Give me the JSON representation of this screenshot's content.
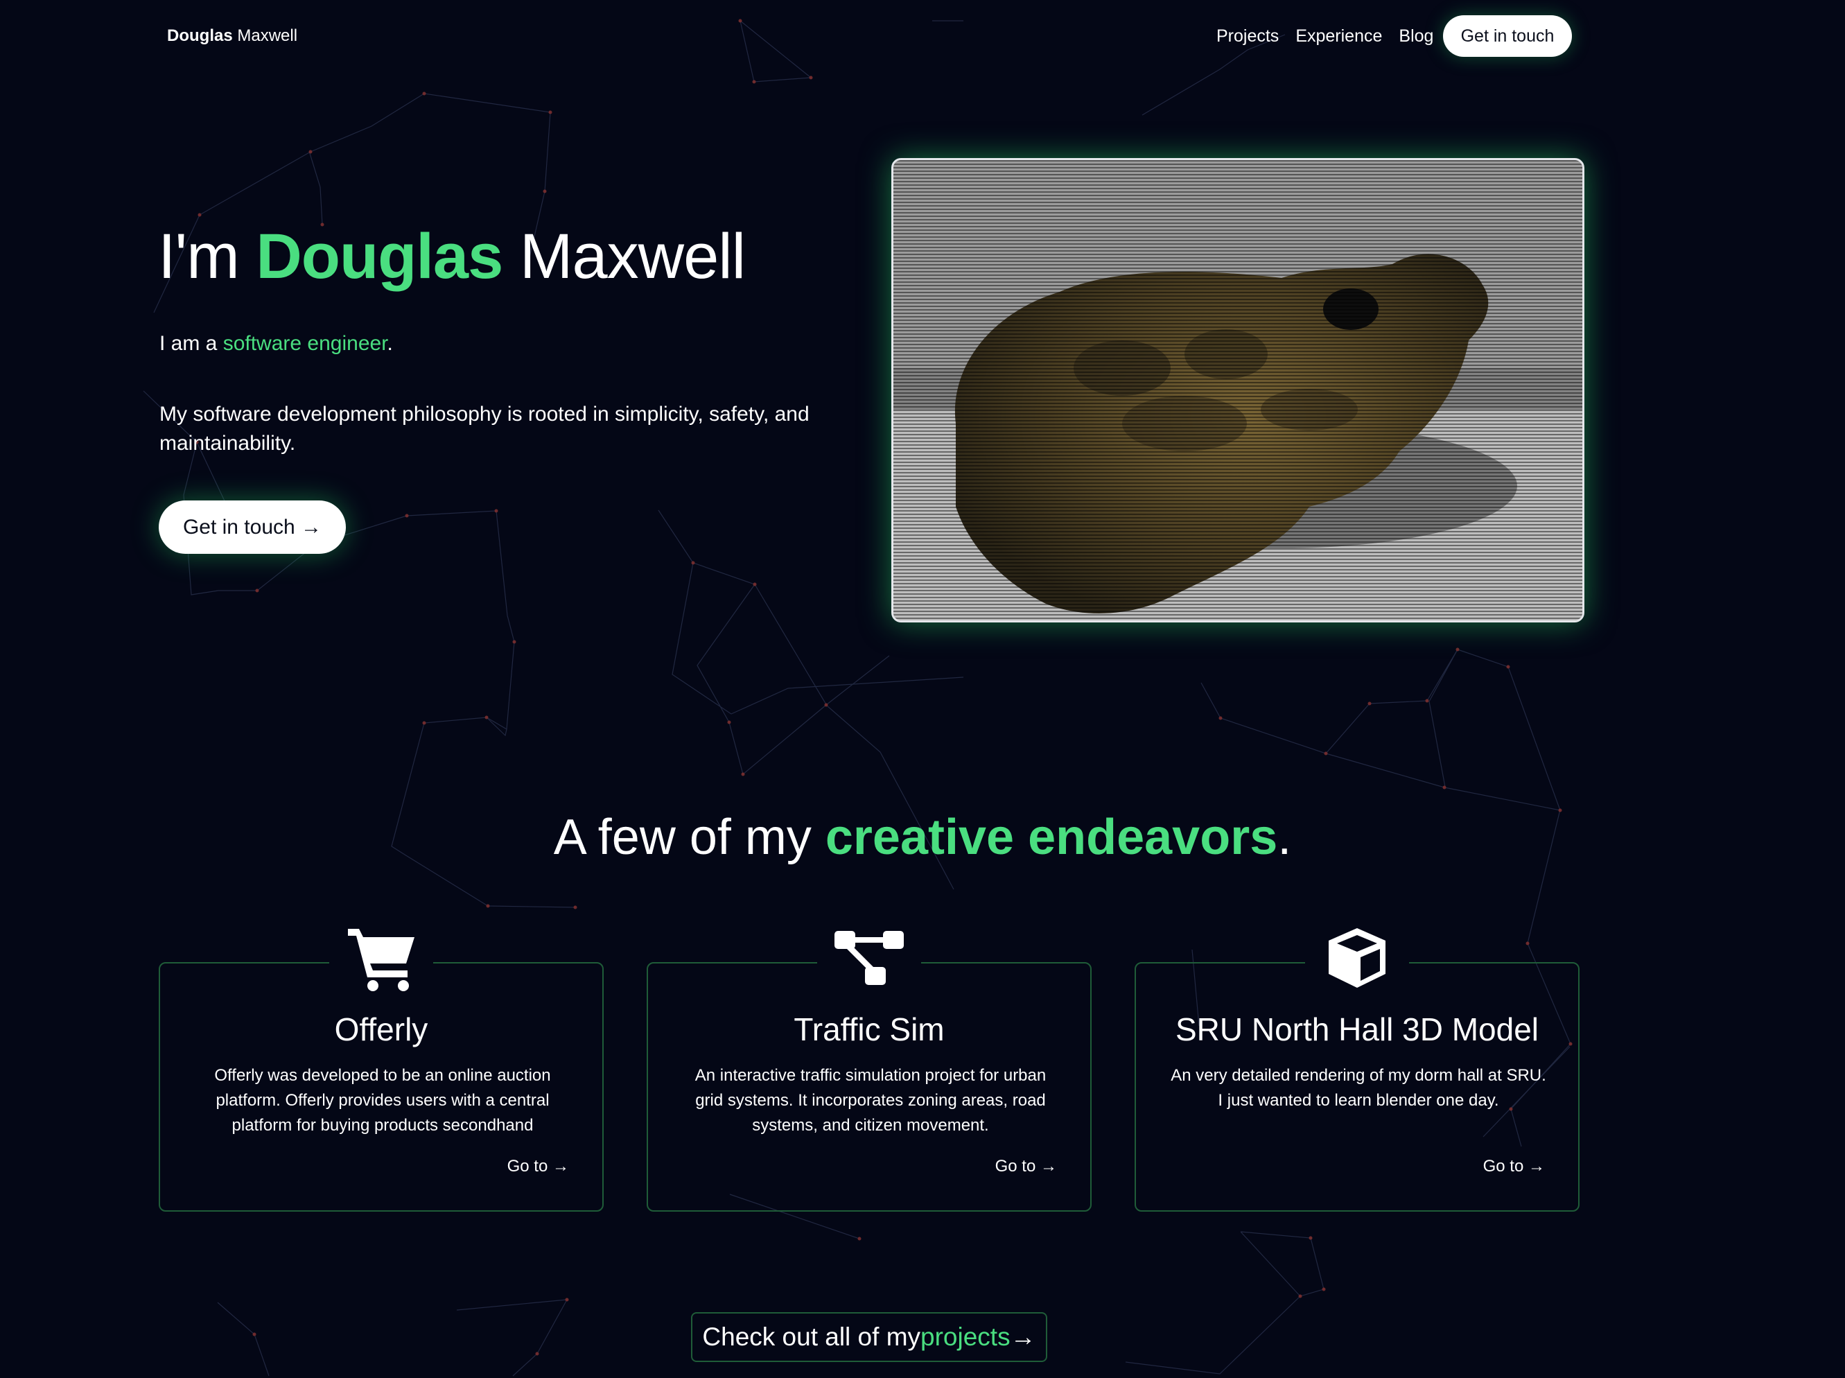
{
  "nav": {
    "brand_first": "Douglas",
    "brand_last": " Maxwell",
    "links": [
      "Projects",
      "Experience",
      "Blog"
    ],
    "cta_label": "Get in touch"
  },
  "hero": {
    "title_prefix": "I'm ",
    "title_first": "Douglas",
    "title_last": " Maxwell",
    "role_prefix": "I am a ",
    "role": "software engineer",
    "role_suffix": ".",
    "philosophy": "My software development philosophy is rooted in simplicity, safety, and maintainability.",
    "cta_label": "Get in touch →"
  },
  "section": {
    "title_prefix": "A few of my ",
    "title_highlight": "creative endeavors",
    "title_suffix": "."
  },
  "projects": [
    {
      "icon": "shopping-cart-icon",
      "title": "Offerly",
      "description": "Offerly was developed to be an online auction platform. Offerly provides users with a central platform for buying products secondhand",
      "link": "Go to →"
    },
    {
      "icon": "network-diagram-icon",
      "title": "Traffic Sim",
      "description": "An interactive traffic simulation project for urban grid systems. It incorporates zoning areas, road systems, and citizen movement.",
      "link": "Go to →"
    },
    {
      "icon": "cube-icon",
      "title": "SRU North Hall 3D Model",
      "description": "An very detailed rendering of my dorm hall at SRU. I just wanted to learn blender one day.",
      "link": "Go to →"
    }
  ],
  "projects_cta": {
    "prefix": "Check out all of my ",
    "highlight": "projects",
    "suffix": " →"
  },
  "colors": {
    "background": "#040716",
    "accent": "#4ade80",
    "card_border": "#1f5c38"
  }
}
